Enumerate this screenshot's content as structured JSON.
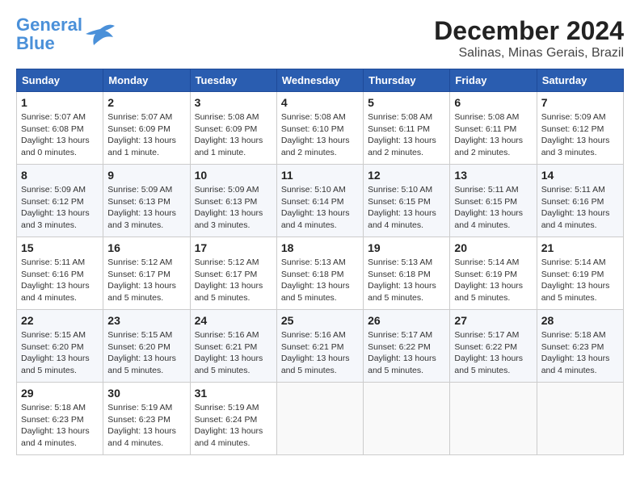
{
  "header": {
    "logo_line1": "General",
    "logo_line2": "Blue",
    "month": "December 2024",
    "location": "Salinas, Minas Gerais, Brazil"
  },
  "weekdays": [
    "Sunday",
    "Monday",
    "Tuesday",
    "Wednesday",
    "Thursday",
    "Friday",
    "Saturday"
  ],
  "weeks": [
    [
      {
        "day": "1",
        "info": "Sunrise: 5:07 AM\nSunset: 6:08 PM\nDaylight: 13 hours\nand 0 minutes."
      },
      {
        "day": "2",
        "info": "Sunrise: 5:07 AM\nSunset: 6:09 PM\nDaylight: 13 hours\nand 1 minute."
      },
      {
        "day": "3",
        "info": "Sunrise: 5:08 AM\nSunset: 6:09 PM\nDaylight: 13 hours\nand 1 minute."
      },
      {
        "day": "4",
        "info": "Sunrise: 5:08 AM\nSunset: 6:10 PM\nDaylight: 13 hours\nand 2 minutes."
      },
      {
        "day": "5",
        "info": "Sunrise: 5:08 AM\nSunset: 6:11 PM\nDaylight: 13 hours\nand 2 minutes."
      },
      {
        "day": "6",
        "info": "Sunrise: 5:08 AM\nSunset: 6:11 PM\nDaylight: 13 hours\nand 2 minutes."
      },
      {
        "day": "7",
        "info": "Sunrise: 5:09 AM\nSunset: 6:12 PM\nDaylight: 13 hours\nand 3 minutes."
      }
    ],
    [
      {
        "day": "8",
        "info": "Sunrise: 5:09 AM\nSunset: 6:12 PM\nDaylight: 13 hours\nand 3 minutes."
      },
      {
        "day": "9",
        "info": "Sunrise: 5:09 AM\nSunset: 6:13 PM\nDaylight: 13 hours\nand 3 minutes."
      },
      {
        "day": "10",
        "info": "Sunrise: 5:09 AM\nSunset: 6:13 PM\nDaylight: 13 hours\nand 3 minutes."
      },
      {
        "day": "11",
        "info": "Sunrise: 5:10 AM\nSunset: 6:14 PM\nDaylight: 13 hours\nand 4 minutes."
      },
      {
        "day": "12",
        "info": "Sunrise: 5:10 AM\nSunset: 6:15 PM\nDaylight: 13 hours\nand 4 minutes."
      },
      {
        "day": "13",
        "info": "Sunrise: 5:11 AM\nSunset: 6:15 PM\nDaylight: 13 hours\nand 4 minutes."
      },
      {
        "day": "14",
        "info": "Sunrise: 5:11 AM\nSunset: 6:16 PM\nDaylight: 13 hours\nand 4 minutes."
      }
    ],
    [
      {
        "day": "15",
        "info": "Sunrise: 5:11 AM\nSunset: 6:16 PM\nDaylight: 13 hours\nand 4 minutes."
      },
      {
        "day": "16",
        "info": "Sunrise: 5:12 AM\nSunset: 6:17 PM\nDaylight: 13 hours\nand 5 minutes."
      },
      {
        "day": "17",
        "info": "Sunrise: 5:12 AM\nSunset: 6:17 PM\nDaylight: 13 hours\nand 5 minutes."
      },
      {
        "day": "18",
        "info": "Sunrise: 5:13 AM\nSunset: 6:18 PM\nDaylight: 13 hours\nand 5 minutes."
      },
      {
        "day": "19",
        "info": "Sunrise: 5:13 AM\nSunset: 6:18 PM\nDaylight: 13 hours\nand 5 minutes."
      },
      {
        "day": "20",
        "info": "Sunrise: 5:14 AM\nSunset: 6:19 PM\nDaylight: 13 hours\nand 5 minutes."
      },
      {
        "day": "21",
        "info": "Sunrise: 5:14 AM\nSunset: 6:19 PM\nDaylight: 13 hours\nand 5 minutes."
      }
    ],
    [
      {
        "day": "22",
        "info": "Sunrise: 5:15 AM\nSunset: 6:20 PM\nDaylight: 13 hours\nand 5 minutes."
      },
      {
        "day": "23",
        "info": "Sunrise: 5:15 AM\nSunset: 6:20 PM\nDaylight: 13 hours\nand 5 minutes."
      },
      {
        "day": "24",
        "info": "Sunrise: 5:16 AM\nSunset: 6:21 PM\nDaylight: 13 hours\nand 5 minutes."
      },
      {
        "day": "25",
        "info": "Sunrise: 5:16 AM\nSunset: 6:21 PM\nDaylight: 13 hours\nand 5 minutes."
      },
      {
        "day": "26",
        "info": "Sunrise: 5:17 AM\nSunset: 6:22 PM\nDaylight: 13 hours\nand 5 minutes."
      },
      {
        "day": "27",
        "info": "Sunrise: 5:17 AM\nSunset: 6:22 PM\nDaylight: 13 hours\nand 5 minutes."
      },
      {
        "day": "28",
        "info": "Sunrise: 5:18 AM\nSunset: 6:23 PM\nDaylight: 13 hours\nand 4 minutes."
      }
    ],
    [
      {
        "day": "29",
        "info": "Sunrise: 5:18 AM\nSunset: 6:23 PM\nDaylight: 13 hours\nand 4 minutes."
      },
      {
        "day": "30",
        "info": "Sunrise: 5:19 AM\nSunset: 6:23 PM\nDaylight: 13 hours\nand 4 minutes."
      },
      {
        "day": "31",
        "info": "Sunrise: 5:19 AM\nSunset: 6:24 PM\nDaylight: 13 hours\nand 4 minutes."
      },
      {
        "day": "",
        "info": ""
      },
      {
        "day": "",
        "info": ""
      },
      {
        "day": "",
        "info": ""
      },
      {
        "day": "",
        "info": ""
      }
    ]
  ]
}
